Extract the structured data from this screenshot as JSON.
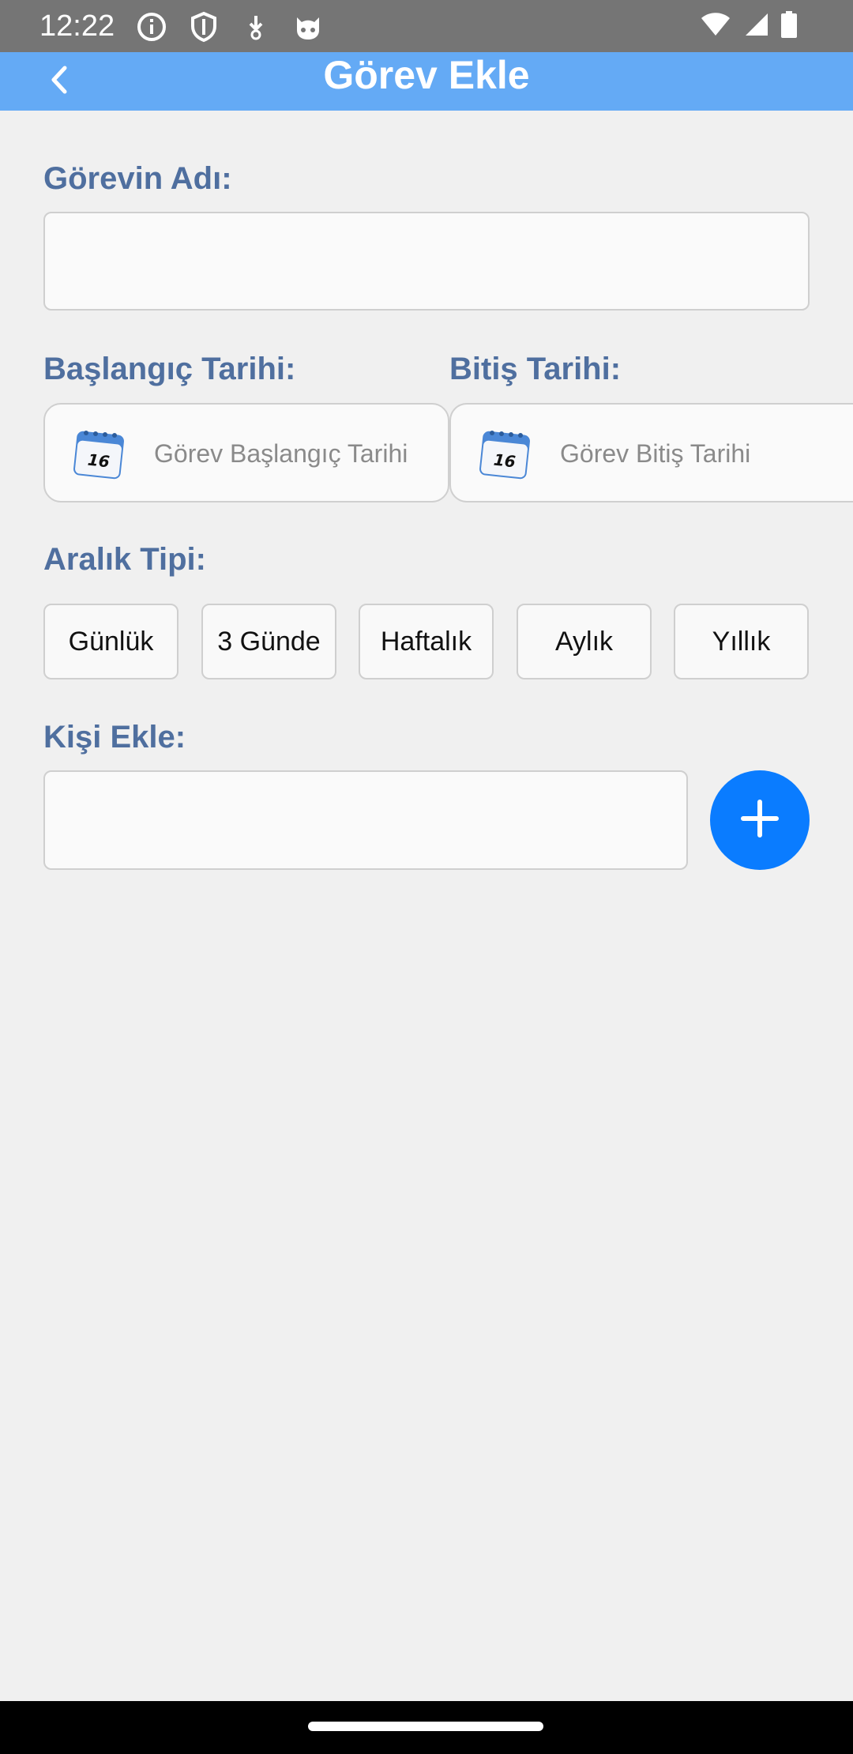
{
  "status_bar": {
    "time": "12:22",
    "left_icons": [
      "info-icon",
      "shield-icon",
      "download-icon",
      "cat-face-icon"
    ],
    "right_icons": [
      "wifi-icon",
      "cell-signal-icon",
      "battery-icon"
    ]
  },
  "app_bar": {
    "title": "Görev Ekle",
    "back_icon": "chevron-left-icon",
    "color": "#64aaf5"
  },
  "form": {
    "task_name": {
      "label": "Görevin Adı:",
      "value": ""
    },
    "start_date": {
      "label": "Başlangıç Tarihi:",
      "placeholder": "Görev Başlangıç Tarihi",
      "icon": "calendar-icon"
    },
    "end_date": {
      "label": "Bitiş Tarihi:",
      "placeholder": "Görev Bitiş Tarihi",
      "icon": "calendar-icon"
    },
    "interval": {
      "label": "Aralık Tipi:",
      "options": [
        "Günlük",
        "3 Günde",
        "Haftalık",
        "Aylık",
        "Yıllık"
      ]
    },
    "person": {
      "label": "Kişi Ekle:",
      "value": "",
      "add_icon": "plus-icon"
    },
    "calendar_day": "16"
  },
  "colors": {
    "label": "#4f6f9f",
    "accent": "#0a7cff",
    "background": "#f0f0f0"
  }
}
